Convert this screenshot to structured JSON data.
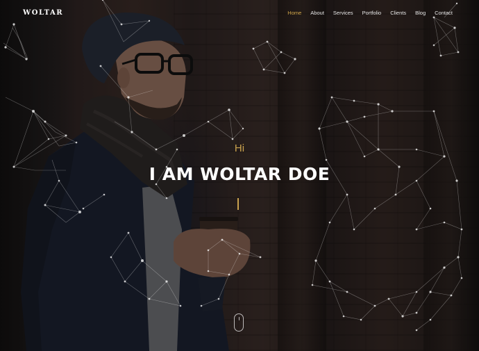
{
  "brand": {
    "logo_text": "Woltar"
  },
  "nav": {
    "items": [
      {
        "label": "Home",
        "active": true
      },
      {
        "label": "About",
        "active": false
      },
      {
        "label": "Services",
        "active": false
      },
      {
        "label": "Portfolio",
        "active": false
      },
      {
        "label": "Clients",
        "active": false
      },
      {
        "label": "Blog",
        "active": false
      },
      {
        "label": "Contact",
        "active": false
      }
    ]
  },
  "hero": {
    "greeting": "Hi",
    "headline": "I AM WOLTAR DOE",
    "typed_text": ""
  },
  "colors": {
    "accent": "#c9a24e",
    "text": "#ffffff",
    "overlay": "#0a0808"
  },
  "icons": {
    "scroll": "mouse-scroll-icon"
  }
}
